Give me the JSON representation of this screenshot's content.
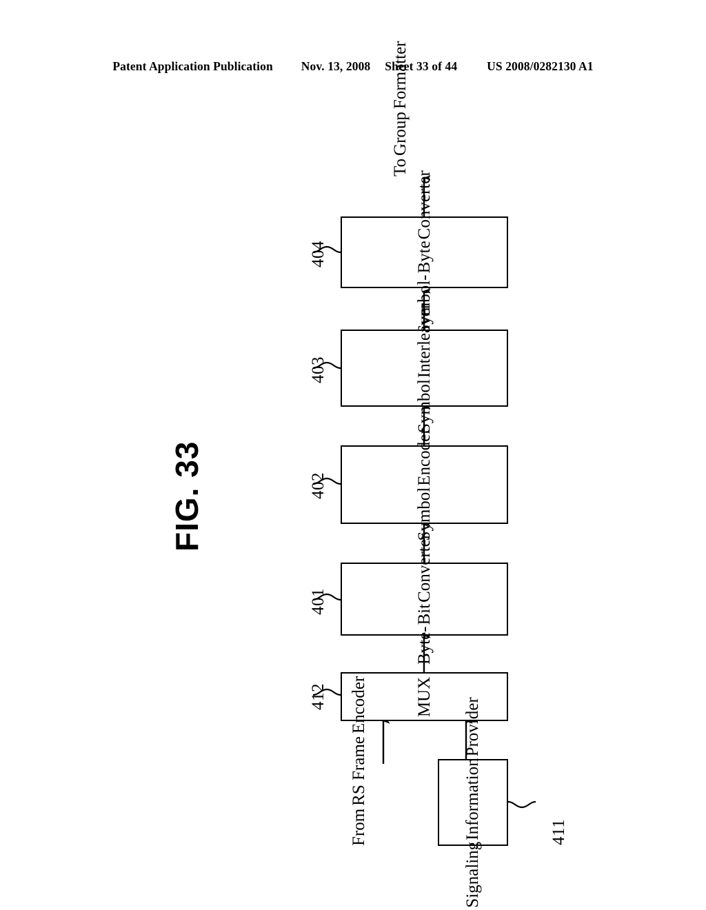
{
  "header": {
    "publication": "Patent Application Publication",
    "date": "Nov. 13, 2008",
    "sheet": "Sheet 33 of 44",
    "docnum": "US 2008/0282130 A1"
  },
  "figure": {
    "title": "FIG. 33"
  },
  "labels": {
    "output_destination": [
      "To",
      "Group",
      "Formatter"
    ],
    "input_source": [
      "From",
      "RS Frame",
      "Encoder"
    ]
  },
  "blocks": [
    {
      "id": "symbol-byte-converter",
      "ref": "404",
      "lines": [
        "Symbol-",
        "Byte",
        "Converter"
      ]
    },
    {
      "id": "symbol-interleaver",
      "ref": "403",
      "lines": [
        "Symbol",
        "Interleaver"
      ]
    },
    {
      "id": "symbol-encoder",
      "ref": "402",
      "lines": [
        "Symbol",
        "Encoder"
      ]
    },
    {
      "id": "byte-bit-converter",
      "ref": "401",
      "lines": [
        "Byte-",
        "Bit",
        "Converter"
      ]
    },
    {
      "id": "mux",
      "ref": "412",
      "lines": [
        "MUX"
      ]
    },
    {
      "id": "signaling-information-provider",
      "ref": "411",
      "lines": [
        "Signaling",
        "Information",
        "Provider"
      ]
    }
  ],
  "colors": {
    "ink": "#000000",
    "paper": "#ffffff"
  }
}
